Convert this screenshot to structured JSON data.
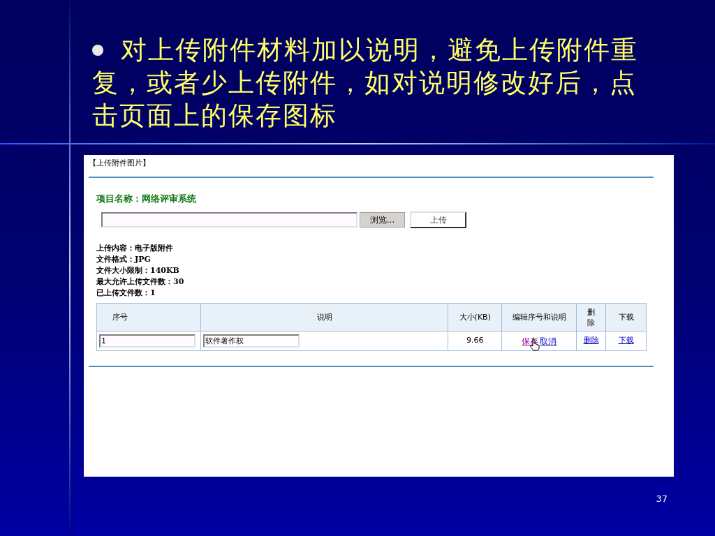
{
  "slide": {
    "bullet_lines": [
      "对上传附件材料加以说明，避免上传附件重",
      "复，或者少上传附件，如对说明修改好后，点",
      "击页面上的保存图标"
    ],
    "page_number": "37"
  },
  "screenshot": {
    "heading": "【上传附件图片】",
    "project_label": "项目名称：网络评审系统",
    "buttons": [
      {
        "kind": "browse",
        "label": "浏览..."
      },
      {
        "kind": "submit",
        "label": "上传"
      }
    ],
    "info": [
      "上传内容：电子版附件",
      "文件格式：JPG",
      "文件大小限制：140KB",
      "最大允许上传文件数：30",
      "已上传文件数：1"
    ],
    "table": {
      "columns": [
        "序号",
        "说明",
        "大小(KB)",
        "编辑序号和说明",
        "删除",
        "下载"
      ],
      "rows": [
        {
          "index": "1",
          "description": "软件著作权",
          "size": "9.66",
          "actions": [
            {
              "label": "保存",
              "color": "#990099"
            },
            {
              "label": "取消",
              "color": "#0000cc"
            }
          ],
          "delete": "删除",
          "download": "下载"
        }
      ]
    }
  }
}
